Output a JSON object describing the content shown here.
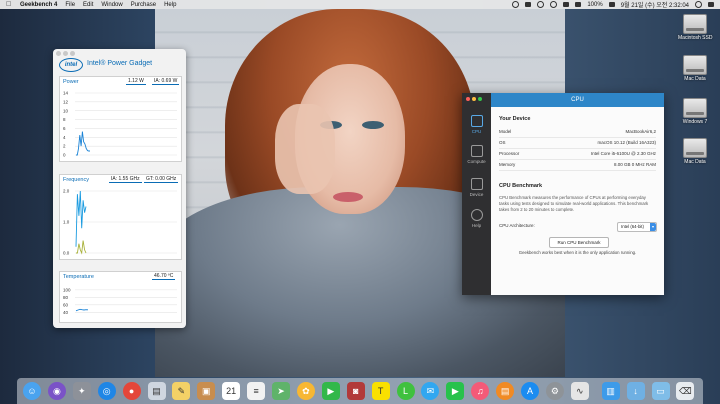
{
  "menubar": {
    "app_name": "Geekbench 4",
    "items": [
      "File",
      "Edit",
      "Window",
      "Purchase",
      "Help"
    ],
    "battery": "100%",
    "clock": "9월 21일 (수) 오전 2:32:04"
  },
  "desktop_disks": [
    {
      "label": "Macintosh SSD"
    },
    {
      "label": "Mac Data"
    },
    {
      "label": "Windows 7"
    },
    {
      "label": "Mac Data"
    }
  ],
  "power_gadget": {
    "title": "Intel® Power Gadget",
    "logo_text": "intel",
    "power": {
      "title": "Power",
      "value1": "1.12 W",
      "value2": "IA: 0.69 W",
      "ticks": [
        "14",
        "12",
        "10",
        "8",
        "6",
        "4",
        "2",
        "0"
      ],
      "series": [
        0,
        0,
        1.5,
        4.5,
        2,
        5.3,
        3,
        2.5,
        1.5,
        1,
        0.9,
        0.9
      ]
    },
    "frequency": {
      "title": "Frequency",
      "value1": "IA: 1.55 GHz",
      "value2": "GT: 0.00 GHz",
      "ticks": [
        "2.0",
        "1.0",
        "0.0"
      ],
      "series_ia": [
        0.2,
        1.9,
        1.2,
        2.0,
        0.8,
        1.7,
        1.3,
        1.5
      ],
      "series_gt": [
        0,
        0,
        0.3,
        0.1,
        0,
        0.4,
        0.1,
        0
      ]
    },
    "temperature": {
      "title": "Temperature",
      "value1": "46.70 ºC",
      "ticks": [
        "100",
        "80",
        "60",
        "40"
      ],
      "series": [
        44,
        46,
        48,
        47,
        46,
        47,
        46.7
      ]
    }
  },
  "geekbench": {
    "window_title": "CPU",
    "nav": [
      {
        "label": "CPU",
        "active": true
      },
      {
        "label": "Compute",
        "active": false
      },
      {
        "label": "Device",
        "active": false
      },
      {
        "label": "Help",
        "active": false
      }
    ],
    "device_heading": "Your Device",
    "device_rows": [
      {
        "key": "Model",
        "value": "MacBookAir6,2"
      },
      {
        "key": "OS",
        "value": "macOS 10.12 (Build 16A323)"
      },
      {
        "key": "Processor",
        "value": "Intel Core i5-6100U @ 2.30 GHz"
      },
      {
        "key": "Memory",
        "value": "8.00 GB 0 MHz RAM"
      }
    ],
    "benchmark_heading": "CPU Benchmark",
    "benchmark_desc": "CPU Benchmark measures the performance of CPUs at performing everyday tasks using tests designed to simulate real-world applications. This benchmark takes from 2 to 20 minutes to complete.",
    "arch_label": "CPU Architecture:",
    "arch_value": "Intel (64-bit)",
    "run_button": "Run CPU Benchmark",
    "note": "Geekbench works best when it is the only application running."
  },
  "dock_apps": [
    "Finder",
    "Siri",
    "Launchpad",
    "Safari",
    "Chrome",
    "Preview",
    "Notes",
    "Contacts",
    "Calendar",
    "Reminders",
    "Maps",
    "Photos",
    "FaceTime",
    "Photo Booth",
    "KakaoTalk",
    "LINE",
    "Messages",
    "FaceTime Video",
    "iTunes",
    "iBooks",
    "App Store",
    "System Preferences",
    "Geekbench",
    "Activity",
    "Downloads",
    "Folder",
    "Trash"
  ]
}
